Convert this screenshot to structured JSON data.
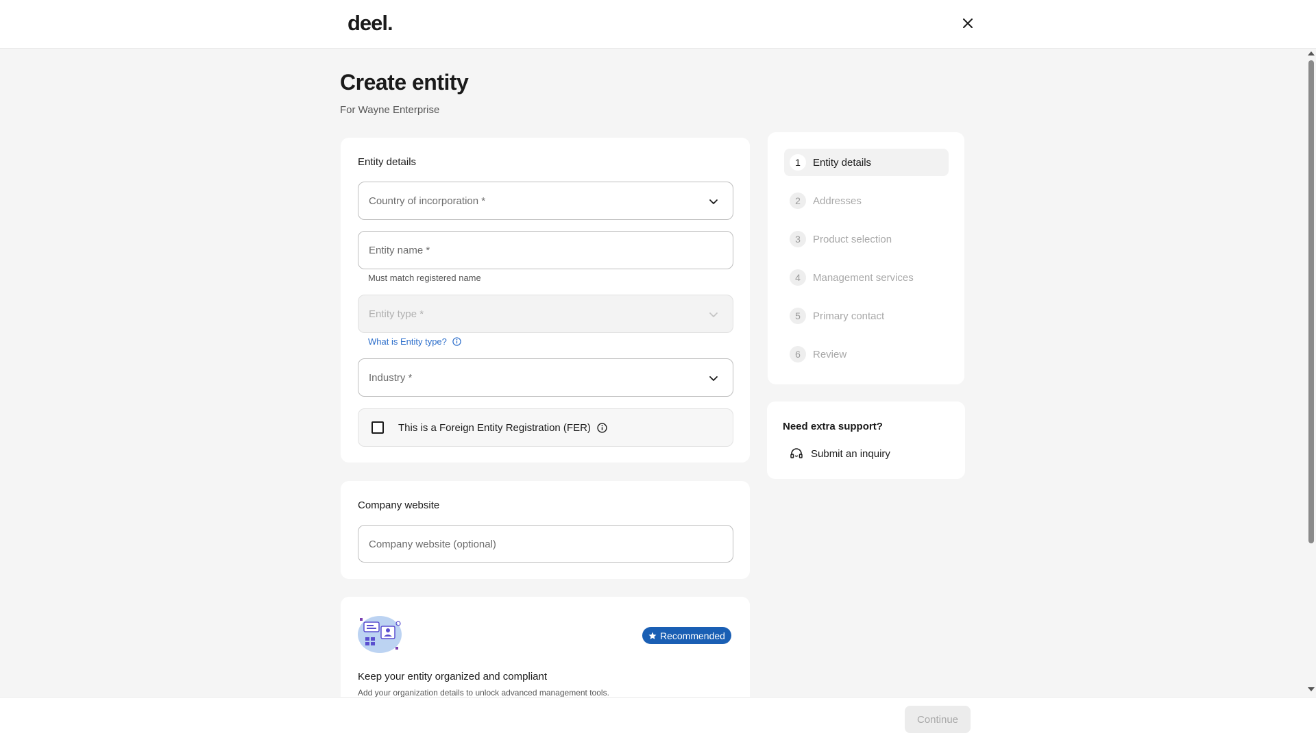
{
  "header": {
    "logo": "deel."
  },
  "page": {
    "title": "Create entity",
    "subtitle": "For Wayne Enterprise"
  },
  "entity_details": {
    "title": "Entity details",
    "country_placeholder": "Country of incorporation *",
    "entity_name_placeholder": "Entity name *",
    "entity_name_helper": "Must match registered name",
    "entity_type_placeholder": "Entity type *",
    "entity_type_link": "What is Entity type?",
    "industry_placeholder": "Industry *",
    "fer_label": "This is a Foreign Entity Registration (FER)"
  },
  "company_website": {
    "title": "Company website",
    "placeholder": "Company website (optional)"
  },
  "promo": {
    "badge": "Recommended",
    "title": "Keep your entity organized and compliant",
    "description": "Add your organization details to unlock advanced management tools."
  },
  "steps": [
    {
      "num": "1",
      "label": "Entity details",
      "active": true
    },
    {
      "num": "2",
      "label": "Addresses",
      "active": false
    },
    {
      "num": "3",
      "label": "Product selection",
      "active": false
    },
    {
      "num": "4",
      "label": "Management services",
      "active": false
    },
    {
      "num": "5",
      "label": "Primary contact",
      "active": false
    },
    {
      "num": "6",
      "label": "Review",
      "active": false
    }
  ],
  "support": {
    "title": "Need extra support?",
    "link": "Submit an inquiry"
  },
  "footer": {
    "continue_label": "Continue"
  },
  "colors": {
    "accent": "#1a5fb4",
    "link": "#2c6ecb",
    "background": "#f5f5f5"
  },
  "icons": [
    "close-icon",
    "chevron-down-icon",
    "info-icon",
    "star-icon",
    "headset-icon",
    "organization-illustration"
  ]
}
